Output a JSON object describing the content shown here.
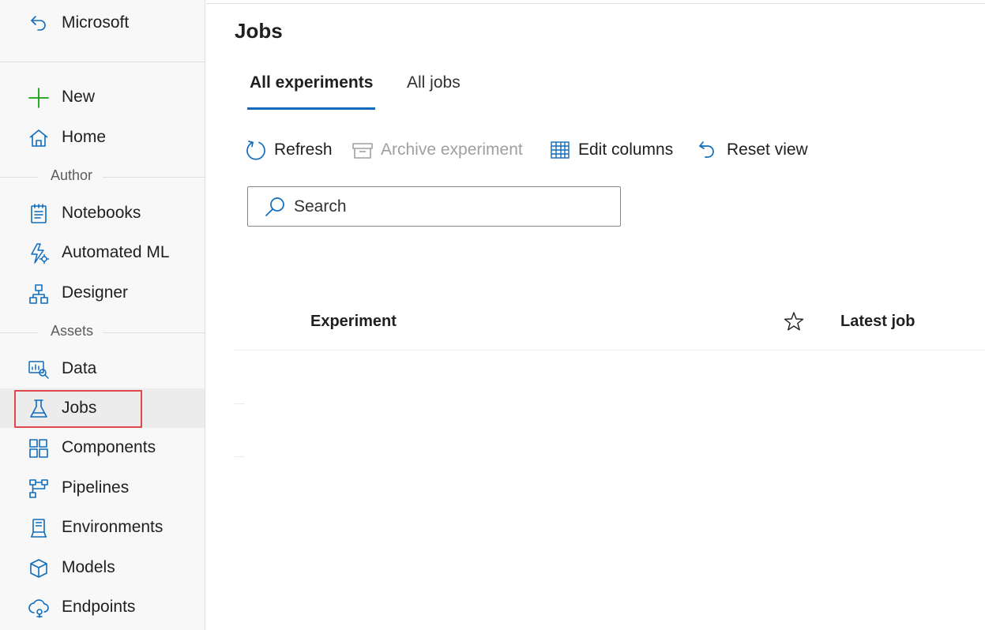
{
  "sidebar": {
    "back_label": "Microsoft",
    "new_label": "New",
    "home_label": "Home",
    "author_section": "Author",
    "notebooks_label": "Notebooks",
    "automl_label": "Automated ML",
    "designer_label": "Designer",
    "assets_section": "Assets",
    "data_label": "Data",
    "jobs_label": "Jobs",
    "components_label": "Components",
    "pipelines_label": "Pipelines",
    "environments_label": "Environments",
    "models_label": "Models",
    "endpoints_label": "Endpoints",
    "selected_item": "Jobs"
  },
  "main": {
    "title": "Jobs",
    "tabs": [
      {
        "label": "All experiments",
        "active": true
      },
      {
        "label": "All jobs",
        "active": false
      }
    ],
    "toolbar": {
      "refresh_label": "Refresh",
      "archive_label": "Archive experiment",
      "edit_columns_label": "Edit columns",
      "reset_view_label": "Reset view"
    },
    "search": {
      "placeholder": "Search",
      "value": ""
    },
    "table": {
      "columns": [
        "Experiment",
        "Latest job"
      ]
    }
  },
  "icons": {
    "back": "back-arrow-icon",
    "new": "plus-icon",
    "home": "home-icon",
    "notebooks": "notebook-icon",
    "automl": "automl-icon",
    "designer": "designer-icon",
    "data": "data-icon",
    "jobs": "flask-icon",
    "components": "components-icon",
    "pipelines": "pipelines-icon",
    "environments": "environments-icon",
    "models": "cube-icon",
    "endpoints": "endpoints-icon",
    "refresh": "refresh-icon",
    "archive": "archive-icon",
    "edit_columns": "table-columns-icon",
    "reset_view": "undo-icon",
    "search": "search-icon",
    "favorite": "star-icon"
  },
  "colors": {
    "accent": "#0f6cbd",
    "new_icon": "#13a10e",
    "selection_outline": "#e0464d",
    "sidebar_bg": "#f8f8f8",
    "disabled_text": "#a19f9d"
  }
}
